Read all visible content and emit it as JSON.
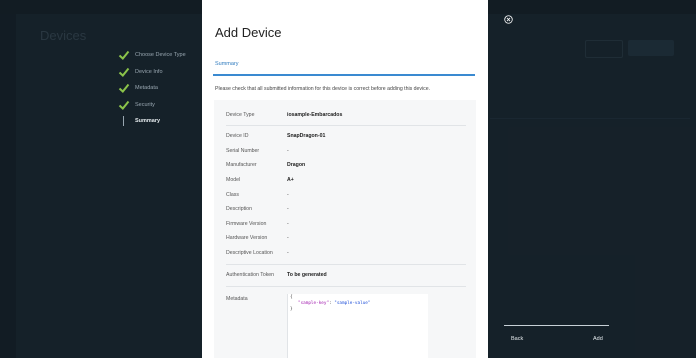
{
  "background": {
    "page_title": "Devices"
  },
  "steps": [
    {
      "label": "Choose Device Type",
      "status": "done"
    },
    {
      "label": "Device Info",
      "status": "done"
    },
    {
      "label": "Metadata",
      "status": "done"
    },
    {
      "label": "Security",
      "status": "done"
    },
    {
      "label": "Summary",
      "status": "active"
    }
  ],
  "panel": {
    "title": "Add Device",
    "tab": "Summary",
    "intro": "Please check that all submitted information for this device is correct before adding this device."
  },
  "summary": {
    "device_type": {
      "label": "Device Type",
      "value": "iosample-Embarcados"
    },
    "device_id": {
      "label": "Device ID",
      "value": "SnapDragon-01"
    },
    "serial_number": {
      "label": "Serial Number",
      "value": "-"
    },
    "manufacturer": {
      "label": "Manufacturer",
      "value": "Dragon"
    },
    "model": {
      "label": "Model",
      "value": "A+"
    },
    "class": {
      "label": "Class",
      "value": "-"
    },
    "description": {
      "label": "Description",
      "value": "-"
    },
    "firmware_version": {
      "label": "Firmware Version",
      "value": "-"
    },
    "hardware_version": {
      "label": "Hardware Version",
      "value": "-"
    },
    "descriptive_location": {
      "label": "Descriptive Location",
      "value": "-"
    },
    "auth_token": {
      "label": "Authentication Token",
      "value": "To be generated"
    },
    "metadata": {
      "label": "Metadata",
      "open_brace": "{",
      "key": "\"sample-key\"",
      "colon": ": ",
      "value": "\"sample-value\"",
      "close_brace": "}"
    }
  },
  "footer": {
    "back_label": "Back",
    "add_label": "Add"
  },
  "colors": {
    "accent": "#3a8ad1",
    "check_green": "#8bc34a",
    "backdrop": "#1d2a33"
  },
  "icons": {
    "close": "close-circle-icon",
    "step_done": "checkmark-icon"
  }
}
